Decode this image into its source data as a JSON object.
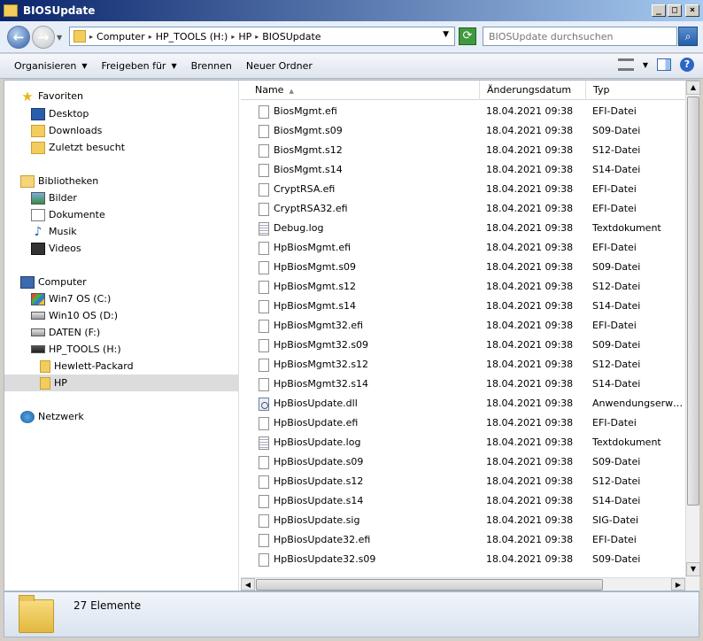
{
  "window": {
    "title": "BIOSUpdate"
  },
  "address": {
    "crumbs": [
      "Computer",
      "HP_TOOLS (H:)",
      "HP",
      "BIOSUpdate"
    ],
    "search_placeholder": "BIOSUpdate durchsuchen"
  },
  "toolbar": {
    "organize": "Organisieren",
    "share": "Freigeben für",
    "burn": "Brennen",
    "new_folder": "Neuer Ordner"
  },
  "nav": {
    "favorites": "Favoriten",
    "desktop": "Desktop",
    "downloads": "Downloads",
    "recent": "Zuletzt besucht",
    "libraries": "Bibliotheken",
    "pictures": "Bilder",
    "documents": "Dokumente",
    "music": "Musik",
    "videos": "Videos",
    "computer": "Computer",
    "win7": "Win7 OS (C:)",
    "win10": "Win10 OS (D:)",
    "daten": "DATEN (F:)",
    "hptools": "HP_TOOLS (H:)",
    "hewlett": "Hewlett-Packard",
    "hp": "HP",
    "network": "Netzwerk"
  },
  "columns": {
    "name": "Name",
    "date": "Änderungsdatum",
    "type": "Typ"
  },
  "files": [
    {
      "name": "BiosMgmt.efi",
      "date": "18.04.2021 09:38",
      "type": "EFI-Datei",
      "icon": "file-icon"
    },
    {
      "name": "BiosMgmt.s09",
      "date": "18.04.2021 09:38",
      "type": "S09-Datei",
      "icon": "file-icon"
    },
    {
      "name": "BiosMgmt.s12",
      "date": "18.04.2021 09:38",
      "type": "S12-Datei",
      "icon": "file-icon"
    },
    {
      "name": "BiosMgmt.s14",
      "date": "18.04.2021 09:38",
      "type": "S14-Datei",
      "icon": "file-icon"
    },
    {
      "name": "CryptRSA.efi",
      "date": "18.04.2021 09:38",
      "type": "EFI-Datei",
      "icon": "file-icon"
    },
    {
      "name": "CryptRSA32.efi",
      "date": "18.04.2021 09:38",
      "type": "EFI-Datei",
      "icon": "file-icon"
    },
    {
      "name": "Debug.log",
      "date": "18.04.2021 09:38",
      "type": "Textdokument",
      "icon": "text-file-icon"
    },
    {
      "name": "HpBiosMgmt.efi",
      "date": "18.04.2021 09:38",
      "type": "EFI-Datei",
      "icon": "file-icon"
    },
    {
      "name": "HpBiosMgmt.s09",
      "date": "18.04.2021 09:38",
      "type": "S09-Datei",
      "icon": "file-icon"
    },
    {
      "name": "HpBiosMgmt.s12",
      "date": "18.04.2021 09:38",
      "type": "S12-Datei",
      "icon": "file-icon"
    },
    {
      "name": "HpBiosMgmt.s14",
      "date": "18.04.2021 09:38",
      "type": "S14-Datei",
      "icon": "file-icon"
    },
    {
      "name": "HpBiosMgmt32.efi",
      "date": "18.04.2021 09:38",
      "type": "EFI-Datei",
      "icon": "file-icon"
    },
    {
      "name": "HpBiosMgmt32.s09",
      "date": "18.04.2021 09:38",
      "type": "S09-Datei",
      "icon": "file-icon"
    },
    {
      "name": "HpBiosMgmt32.s12",
      "date": "18.04.2021 09:38",
      "type": "S12-Datei",
      "icon": "file-icon"
    },
    {
      "name": "HpBiosMgmt32.s14",
      "date": "18.04.2021 09:38",
      "type": "S14-Datei",
      "icon": "file-icon"
    },
    {
      "name": "HpBiosUpdate.dll",
      "date": "18.04.2021 09:38",
      "type": "Anwendungserweiterung",
      "icon": "dll-file-icon"
    },
    {
      "name": "HpBiosUpdate.efi",
      "date": "18.04.2021 09:38",
      "type": "EFI-Datei",
      "icon": "file-icon"
    },
    {
      "name": "HpBiosUpdate.log",
      "date": "18.04.2021 09:38",
      "type": "Textdokument",
      "icon": "text-file-icon"
    },
    {
      "name": "HpBiosUpdate.s09",
      "date": "18.04.2021 09:38",
      "type": "S09-Datei",
      "icon": "file-icon"
    },
    {
      "name": "HpBiosUpdate.s12",
      "date": "18.04.2021 09:38",
      "type": "S12-Datei",
      "icon": "file-icon"
    },
    {
      "name": "HpBiosUpdate.s14",
      "date": "18.04.2021 09:38",
      "type": "S14-Datei",
      "icon": "file-icon"
    },
    {
      "name": "HpBiosUpdate.sig",
      "date": "18.04.2021 09:38",
      "type": "SIG-Datei",
      "icon": "file-icon"
    },
    {
      "name": "HpBiosUpdate32.efi",
      "date": "18.04.2021 09:38",
      "type": "EFI-Datei",
      "icon": "file-icon"
    },
    {
      "name": "HpBiosUpdate32.s09",
      "date": "18.04.2021 09:38",
      "type": "S09-Datei",
      "icon": "file-icon"
    }
  ],
  "status": {
    "count": "27 Elemente"
  }
}
